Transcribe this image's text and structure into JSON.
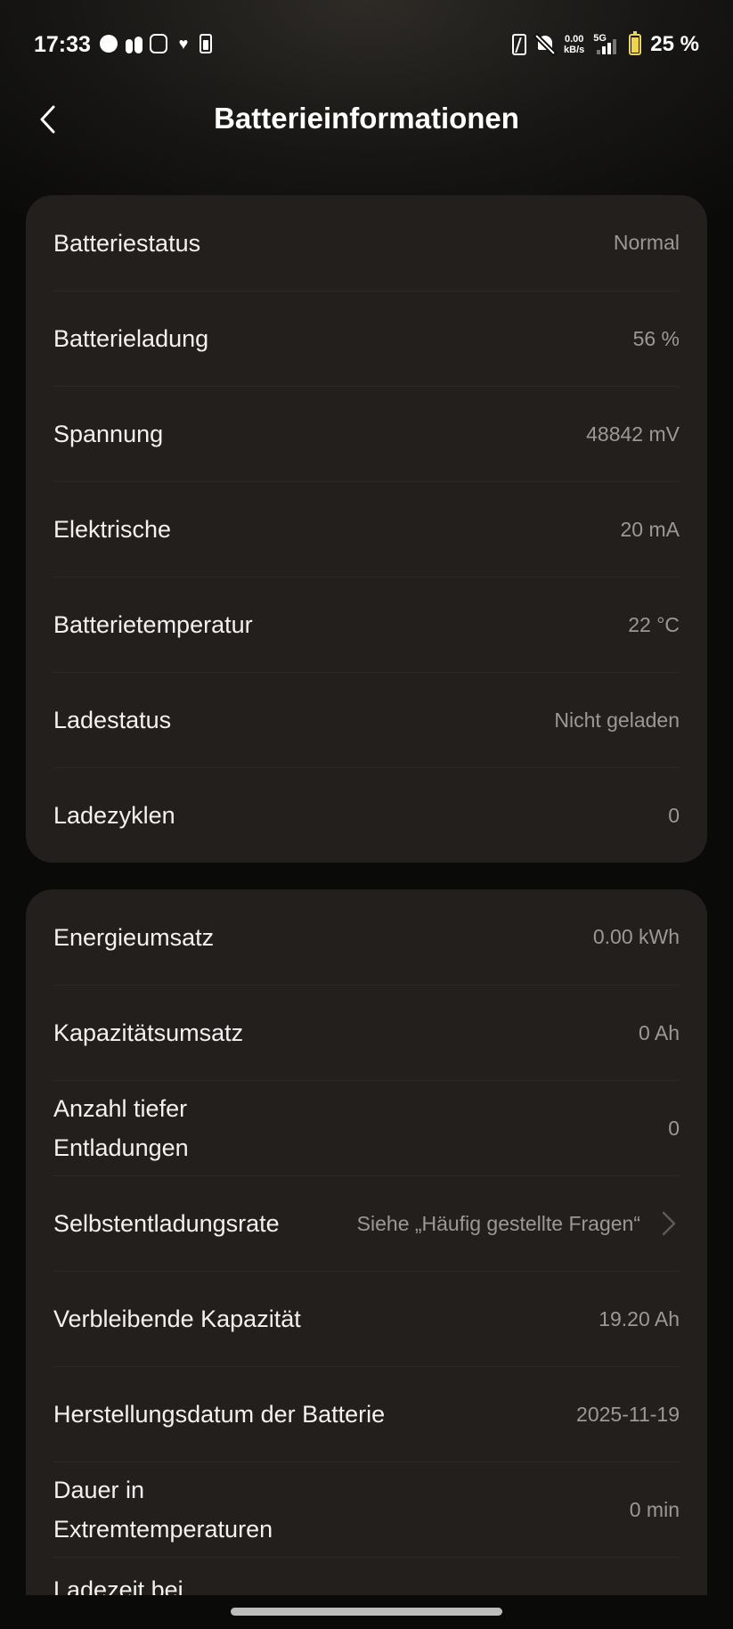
{
  "status_bar": {
    "time": "17:33",
    "speed_value": "0.00",
    "speed_unit": "kB/s",
    "network": "5G",
    "battery_percent": "25 %"
  },
  "header": {
    "title": "Batterieinformationen"
  },
  "card1": {
    "rows": [
      {
        "label": "Batteriestatus",
        "value": "Normal"
      },
      {
        "label": "Batterieladung",
        "value": "56 %"
      },
      {
        "label": "Spannung",
        "value": "48842 mV"
      },
      {
        "label": "Elektrische",
        "value": "20 mA"
      },
      {
        "label": "Batterietemperatur",
        "value": "22 °C"
      },
      {
        "label": "Ladestatus",
        "value": "Nicht geladen"
      },
      {
        "label": "Ladezyklen",
        "value": "0"
      }
    ]
  },
  "card2": {
    "rows": [
      {
        "label": "Energieumsatz",
        "value": "0.00 kWh"
      },
      {
        "label": "Kapazitätsumsatz",
        "value": "0 Ah"
      },
      {
        "label": "Anzahl tiefer Entladungen",
        "value": "0"
      },
      {
        "label": "Selbstentladungsrate",
        "value": "Siehe „Häufig gestellte Fragen“"
      },
      {
        "label": "Verbleibende Kapazität",
        "value": "19.20 Ah"
      },
      {
        "label": "Herstellungsdatum der Batterie",
        "value": "2025-11-19"
      },
      {
        "label": "Dauer in Extremtemperaturen",
        "value": "0 min"
      },
      {
        "label": "Ladezeit bei",
        "value": ""
      }
    ]
  }
}
